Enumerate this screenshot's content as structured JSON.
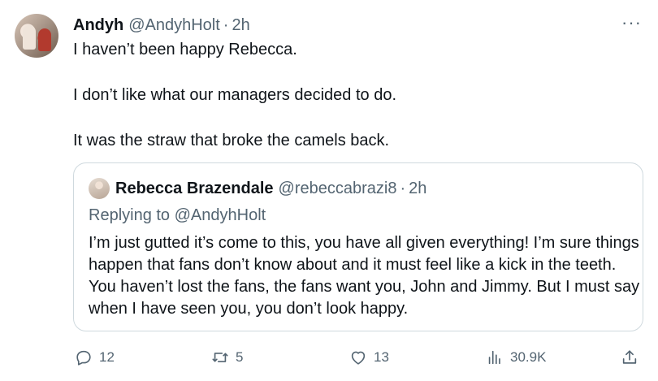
{
  "tweet": {
    "author_name": "Andyh",
    "author_handle": "@AndyhHolt",
    "separator": "·",
    "time": "2h",
    "more_label": "···",
    "paragraphs": [
      "I haven’t been happy Rebecca.",
      "I don’t like what our managers decided to do.",
      "It was the straw that broke the camels back."
    ]
  },
  "quoted": {
    "author_name": "Rebecca Brazendale",
    "author_handle": "@rebeccabrazi8",
    "separator": "·",
    "time": "2h",
    "replying_to": "Replying to @AndyhHolt",
    "text": "I’m just gutted it’s come to this, you have all given everything! I’m sure things happen that fans don’t know about and it must feel like a kick in the teeth. You haven’t lost the fans, the fans want you, John and Jimmy. But I must say when I have seen you, you don’t look happy."
  },
  "actions": {
    "replies": "12",
    "retweets": "5",
    "likes": "13",
    "views": "30.9K",
    "icons": [
      "reply-icon",
      "retweet-icon",
      "like-icon",
      "views-icon",
      "share-icon"
    ]
  },
  "colors": {
    "text": "#0f1419",
    "secondary": "#536471",
    "border": "#cfd9de"
  }
}
